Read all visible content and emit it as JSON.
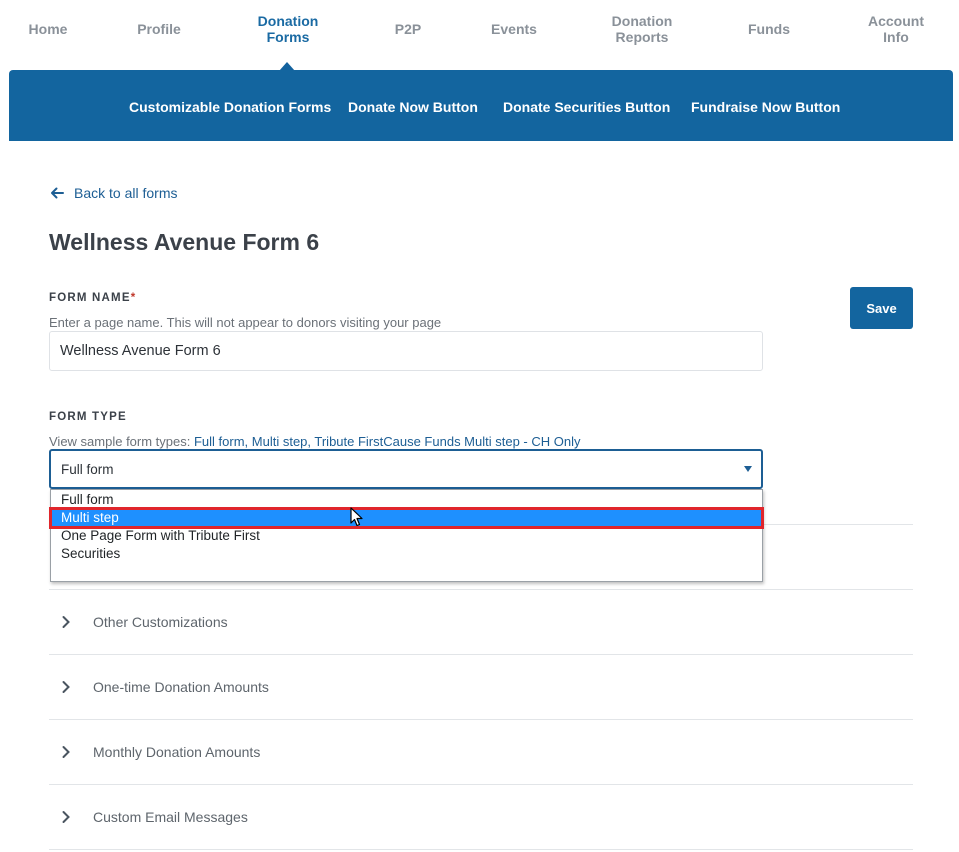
{
  "top_nav": {
    "items": [
      {
        "label_1": "Home",
        "label_2": ""
      },
      {
        "label_1": "Profile",
        "label_2": ""
      },
      {
        "label_1": "Donation",
        "label_2": "Forms"
      },
      {
        "label_1": "P2P",
        "label_2": ""
      },
      {
        "label_1": "Events",
        "label_2": ""
      },
      {
        "label_1": "Donation",
        "label_2": "Reports"
      },
      {
        "label_1": "Funds",
        "label_2": ""
      },
      {
        "label_1": "Account",
        "label_2": "Info"
      }
    ],
    "active_color": "#1a6aa3"
  },
  "sub_nav": {
    "items": [
      "Customizable Donation Forms",
      "Donate Now Button",
      "Donate Securities Button",
      "Fundraise Now Button"
    ],
    "bg_color": "#13659f"
  },
  "back_link": "Back to all forms",
  "page_title": "Wellness Avenue Form 6",
  "form_name": {
    "label": "FORM NAME",
    "required_mark": "*",
    "help": "Enter a page name. This will not appear to donors visiting your page",
    "value": "Wellness Avenue Form 6"
  },
  "save_label": "Save",
  "form_type": {
    "label": "FORM TYPE",
    "help_prefix": "View sample form types: ",
    "help_links": "Full form, Multi step, Tribute FirstCause Funds Multi step - CH Only",
    "selected": "Full form",
    "options": [
      "Full form",
      "Multi step",
      "One Page Form with Tribute First",
      "Securities"
    ],
    "highlighted_option": "Multi step"
  },
  "accordion": [
    "Other Customizations",
    "One-time Donation Amounts",
    "Monthly Donation Amounts",
    "Custom Email Messages"
  ],
  "icons": {
    "back": "arrow-left-icon",
    "select": "caret-down-icon",
    "accordion": "chevron-right-icon",
    "pointer": "mouse-cursor-icon"
  }
}
